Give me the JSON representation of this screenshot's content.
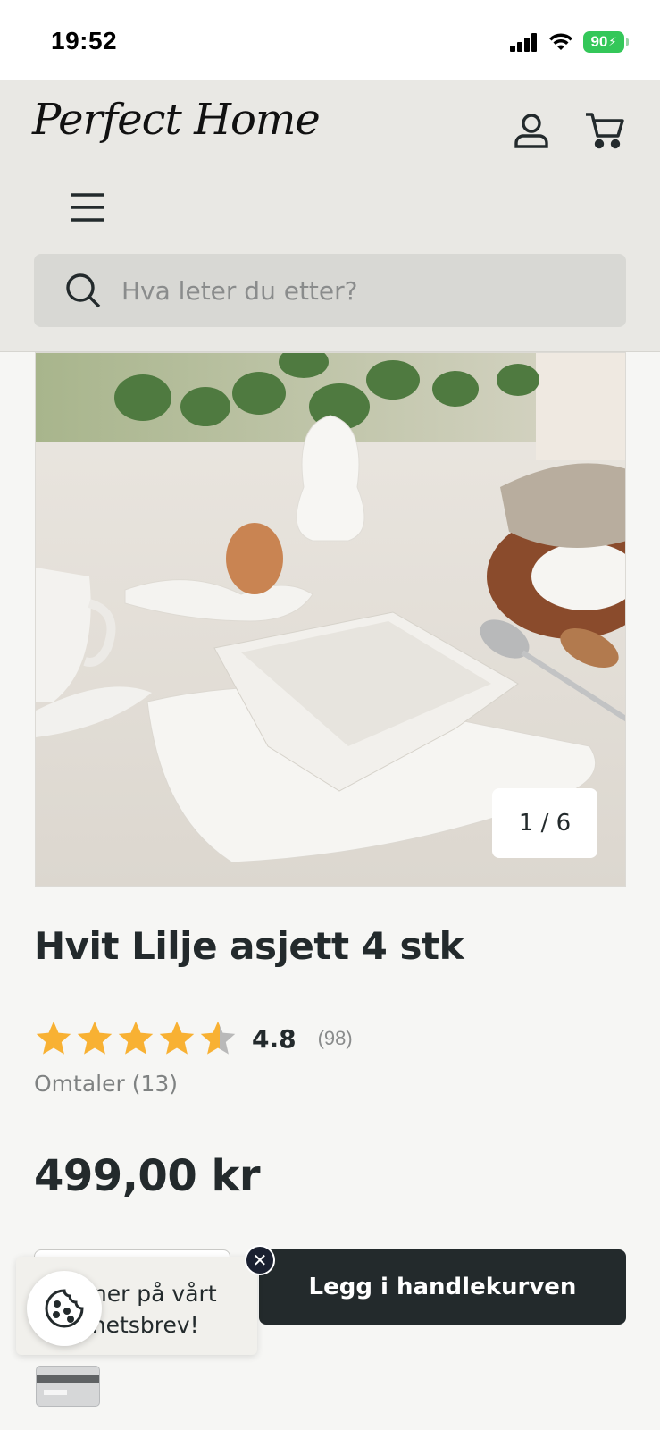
{
  "status_bar": {
    "time": "19:52",
    "battery": "90"
  },
  "header": {
    "logo_text": "Perfect Home",
    "search_placeholder": "Hva leter du etter?"
  },
  "gallery": {
    "counter": "1 / 6"
  },
  "product": {
    "title": "Hvit Lilje asjett 4 stk",
    "rating_value": "4.8",
    "rating_stars": 4.8,
    "rating_count": "(98)",
    "reviews_link": "Omtaler (13)",
    "price": "499,00 kr",
    "add_to_cart_label": "Legg i handlekurven"
  },
  "newsletter_popup": {
    "text": "…nner på vårt …yhetsbrev!",
    "line1": "nner på vårt",
    "line2": "yhetsbrev!",
    "close_label": "✕"
  },
  "colors": {
    "accent": "#232a2c",
    "header_bg": "#e9e8e4",
    "star": "#f8b133",
    "battery": "#34c759"
  },
  "icons": [
    "signal-icon",
    "wifi-icon",
    "battery-icon",
    "account-icon",
    "cart-icon",
    "menu-icon",
    "search-icon",
    "star-icon",
    "cookie-icon",
    "close-icon",
    "card-icon"
  ]
}
